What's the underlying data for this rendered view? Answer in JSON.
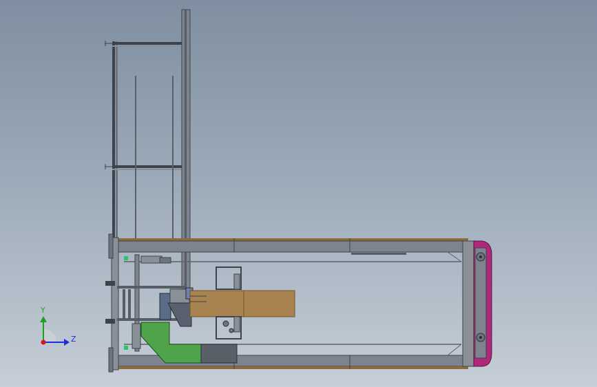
{
  "viewport": {
    "background_top": "#7f8fa1",
    "background_bottom": "#c6ced7"
  },
  "triad": {
    "y_label": "Y",
    "z_label": "Z",
    "y_color": "#1aa31a",
    "z_color": "#1a2fd6",
    "x_color": "#d11919"
  },
  "model": {
    "frame_color": "#4a4f58",
    "frame_fill": "#7d848d",
    "beam_color": "#8b6a3e",
    "box_color": "#a8834f",
    "green_part_color": "#4fa34a",
    "magenta_part_color": "#b0287a",
    "motor_color": "#5a6d86"
  }
}
